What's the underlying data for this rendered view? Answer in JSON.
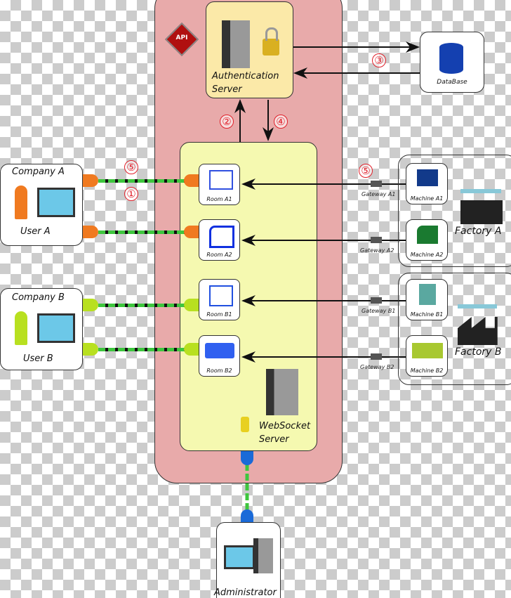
{
  "api_badge": "API",
  "auth_server": {
    "line1": "Authentication",
    "line2": "Server"
  },
  "database": "DataBase",
  "websocket_server": {
    "line1": "WebSocket",
    "line2": "Server"
  },
  "steps": {
    "s1": "①",
    "s2": "②",
    "s3": "③",
    "s4": "④",
    "s5a": "⑤",
    "s5b": "⑤"
  },
  "companies": [
    {
      "name": "Company A",
      "user": "User A",
      "color": "#f07a20"
    },
    {
      "name": "Company B",
      "user": "User B",
      "color": "#b8e020"
    }
  ],
  "rooms": [
    "Room A1",
    "Room A2",
    "Room B1",
    "Room B2"
  ],
  "gateways": [
    "Gateway A1",
    "Gateway A2",
    "Gateway B1",
    "Gateway B2"
  ],
  "machines": [
    "Machine A1",
    "Machine A2",
    "Machine B1",
    "Machine B2"
  ],
  "factories": [
    "Factory A",
    "Factory B"
  ],
  "administrator": "Administrator",
  "colors": {
    "api_zone": "#e8aaaa",
    "auth": "#fbe9a8",
    "websocket": "#f5f9b0",
    "link": "#3ec63e"
  }
}
